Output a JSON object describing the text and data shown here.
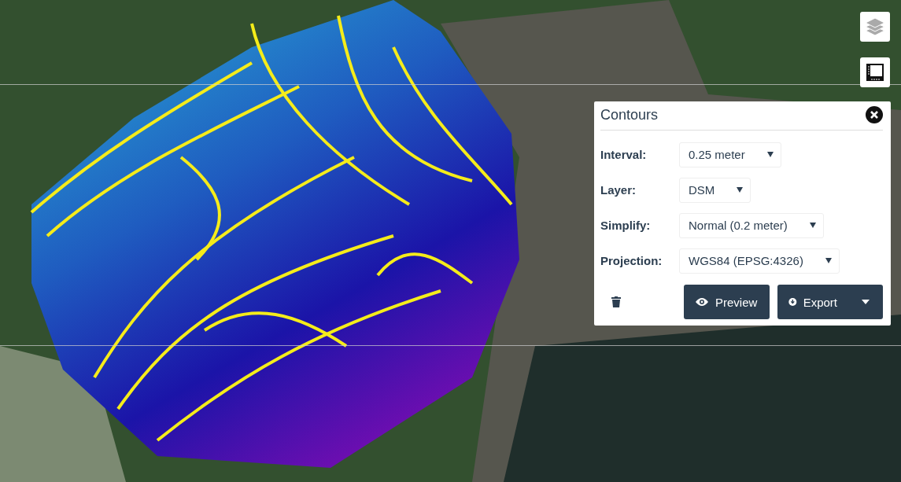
{
  "map_controls": [
    {
      "kind": "layers"
    },
    {
      "kind": "crop"
    }
  ],
  "panel": {
    "title": "Contours",
    "fields": [
      {
        "label": "Interval:",
        "value": "0.25 meter"
      },
      {
        "label": "Layer:",
        "value": "DSM"
      },
      {
        "label": "Simplify:",
        "value": "Normal (0.2 meter)"
      },
      {
        "label": "Projection:",
        "value": "WGS84 (EPSG:4326)"
      }
    ],
    "buttons": [
      {
        "kind": "preview",
        "label": "Preview"
      },
      {
        "kind": "export",
        "label": "Export"
      }
    ]
  }
}
